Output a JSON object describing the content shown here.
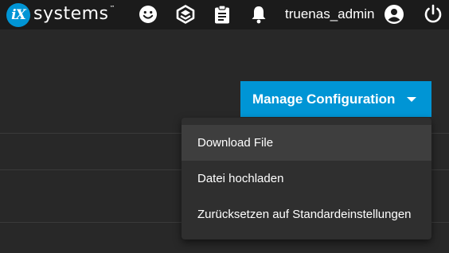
{
  "header": {
    "logo": {
      "badge": "iX",
      "text": "systems",
      "trademark": "™"
    },
    "icons": [
      "feedback-smile-icon",
      "truecommand-icon",
      "task-manager-clipboard-icon",
      "notifications-bell-icon",
      "account-circle-icon",
      "power-icon"
    ],
    "username": "truenas_admin"
  },
  "main": {
    "manage_button": {
      "label": "Manage Configuration",
      "icon": "caret-down-icon"
    },
    "menu": {
      "items": [
        {
          "label": "Download File",
          "highlighted": true
        },
        {
          "label": "Datei hochladen",
          "highlighted": false
        },
        {
          "label": "Zurücksetzen auf Standardeinstellungen",
          "highlighted": false
        }
      ]
    }
  },
  "colors": {
    "topbar": "#1b1b1b",
    "background": "#282828",
    "accent": "#0095d5",
    "menu": "#2f2f2f",
    "menu_highlight": "#3e3e3e"
  }
}
